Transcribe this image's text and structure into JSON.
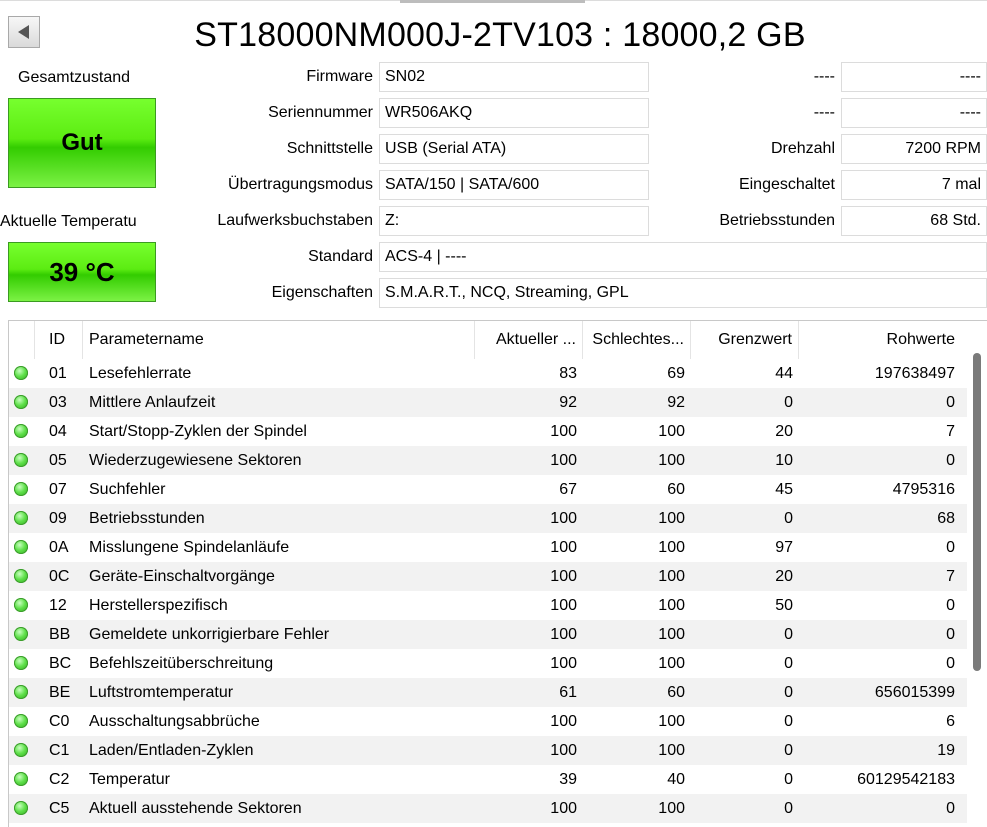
{
  "title": "ST18000NM000J-2TV103 : 18000,2 GB",
  "health": {
    "label": "Gesamtzustand",
    "value": "Gut"
  },
  "temperature": {
    "label": "Aktuelle Temperatu",
    "value": "39 °C"
  },
  "info": {
    "firmware": {
      "label": "Firmware",
      "value": "SN02"
    },
    "serial": {
      "label": "Seriennummer",
      "value": "WR506AKQ"
    },
    "interface": {
      "label": "Schnittstelle",
      "value": "USB (Serial ATA)"
    },
    "transfer_mode": {
      "label": "Übertragungsmodus",
      "value": "SATA/150 | SATA/600"
    },
    "drive_letter": {
      "label": "Laufwerksbuchstaben",
      "value": "Z:"
    },
    "standard": {
      "label": "Standard",
      "value": "ACS-4 | ----"
    },
    "features": {
      "label": "Eigenschaften",
      "value": "S.M.A.R.T., NCQ, Streaming, GPL"
    }
  },
  "right_info": {
    "r1": {
      "label": "----",
      "value": "----"
    },
    "r2": {
      "label": "----",
      "value": "----"
    },
    "rpm": {
      "label": "Drehzahl",
      "value": "7200 RPM"
    },
    "power_on_count": {
      "label": "Eingeschaltet",
      "value": "7 mal"
    },
    "power_on_hours": {
      "label": "Betriebsstunden",
      "value": "68 Std."
    }
  },
  "smart": {
    "columns": [
      "ID",
      "Parametername",
      "Aktueller ...",
      "Schlechtes...",
      "Grenzwert",
      "Rohwerte"
    ],
    "status_color": "#4cd43a",
    "rows": [
      [
        "01",
        "Lesefehlerrate",
        "83",
        "69",
        "44",
        "197638497"
      ],
      [
        "03",
        "Mittlere Anlaufzeit",
        "92",
        "92",
        "0",
        "0"
      ],
      [
        "04",
        "Start/Stopp-Zyklen der Spindel",
        "100",
        "100",
        "20",
        "7"
      ],
      [
        "05",
        "Wiederzugewiesene Sektoren",
        "100",
        "100",
        "10",
        "0"
      ],
      [
        "07",
        "Suchfehler",
        "67",
        "60",
        "45",
        "4795316"
      ],
      [
        "09",
        "Betriebsstunden",
        "100",
        "100",
        "0",
        "68"
      ],
      [
        "0A",
        "Misslungene Spindelanläufe",
        "100",
        "100",
        "97",
        "0"
      ],
      [
        "0C",
        "Geräte-Einschaltvorgänge",
        "100",
        "100",
        "20",
        "7"
      ],
      [
        "12",
        "Herstellerspezifisch",
        "100",
        "100",
        "50",
        "0"
      ],
      [
        "BB",
        "Gemeldete unkorrigierbare Fehler",
        "100",
        "100",
        "0",
        "0"
      ],
      [
        "BC",
        "Befehlszeitüberschreitung",
        "100",
        "100",
        "0",
        "0"
      ],
      [
        "BE",
        "Luftstromtemperatur",
        "61",
        "60",
        "0",
        "656015399"
      ],
      [
        "C0",
        "Ausschaltungsabbrüche",
        "100",
        "100",
        "0",
        "6"
      ],
      [
        "C1",
        "Laden/Entladen-Zyklen",
        "100",
        "100",
        "0",
        "19"
      ],
      [
        "C2",
        "Temperatur",
        "39",
        "40",
        "0",
        "60129542183"
      ],
      [
        "C5",
        "Aktuell ausstehende Sektoren",
        "100",
        "100",
        "0",
        "0"
      ]
    ]
  }
}
